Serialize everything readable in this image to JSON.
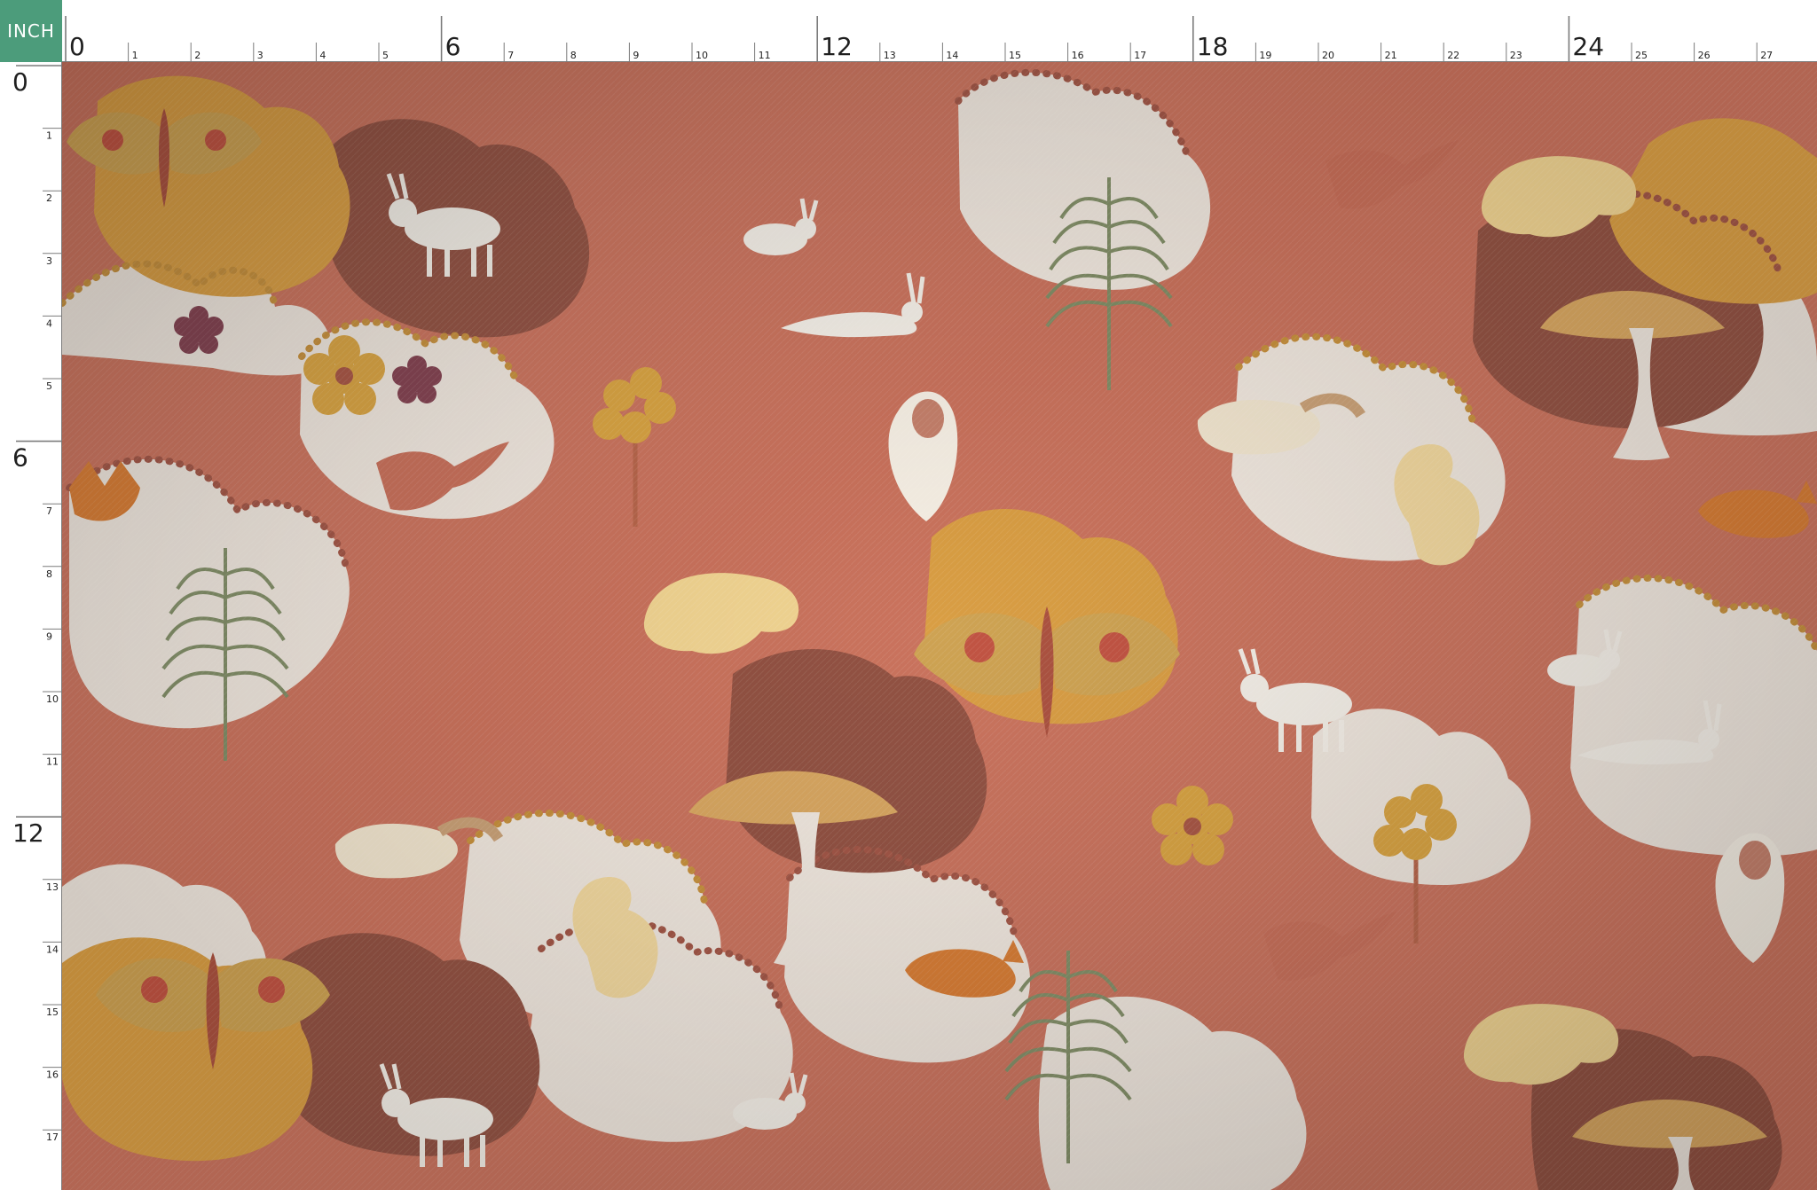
{
  "ruler": {
    "unit_label": "INCH",
    "top_labels": [
      "0",
      "1",
      "2",
      "3",
      "4",
      "5",
      "6",
      "7",
      "8",
      "9",
      "10",
      "11",
      "12",
      "13",
      "14",
      "15",
      "16",
      "17",
      "18",
      "19",
      "20",
      "21",
      "22",
      "23",
      "24",
      "25",
      "26",
      "27"
    ],
    "left_labels": [
      "0",
      "1",
      "2",
      "3",
      "4",
      "5",
      "6",
      "7",
      "8",
      "9",
      "10",
      "11",
      "12",
      "13",
      "14",
      "15",
      "16",
      "17"
    ]
  },
  "colors": {
    "unit_badge": "#4c9c7b",
    "terracotta": "#c96f59",
    "cream": "#efe6dc",
    "mustard": "#d89b3e",
    "brown": "#8f4d3d",
    "sage": "#a5b08a",
    "rust": "#b85d44",
    "ruler_bg": "#ffffff",
    "ruler_ink": "#1f1f1f"
  },
  "pattern": {
    "motifs": [
      "moth-icon",
      "goat-icon",
      "rabbit-icon",
      "hare-icon",
      "bear-icon",
      "owl-icon",
      "fox-icon",
      "raccoon-icon",
      "squirrel-icon",
      "mushroom-icon",
      "bird-icon",
      "flower-icon",
      "fern-icon",
      "tree-icon"
    ]
  }
}
